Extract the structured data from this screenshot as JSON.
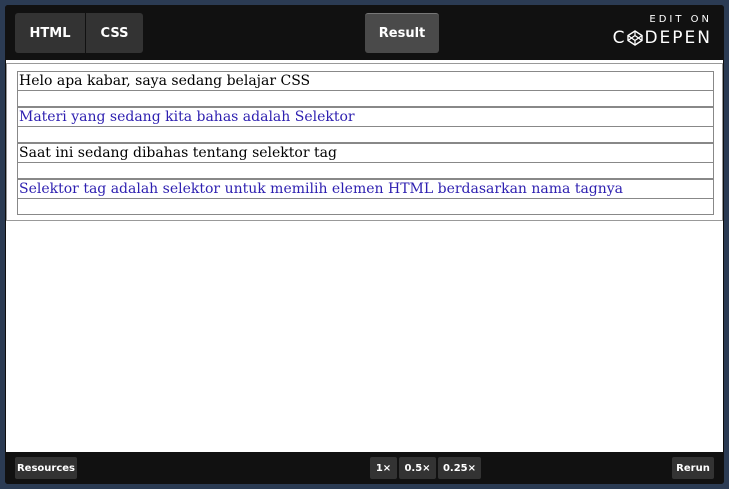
{
  "tabs": {
    "html": "HTML",
    "css": "CSS",
    "result": "Result"
  },
  "branding": {
    "edit_on": "EDIT ON",
    "logo_text_a": "C",
    "logo_text_b": "DEPEN"
  },
  "result": {
    "paragraphs": [
      "Helo apa kabar, saya sedang belajar CSS",
      "Materi yang sedang kita bahas adalah Selektor",
      "Saat ini sedang dibahas tentang selektor tag",
      "Selektor tag adalah selektor untuk memilih elemen HTML berdasarkan nama tagnya"
    ]
  },
  "footer": {
    "resources": "Resources",
    "zoom": [
      "1×",
      "0.5×",
      "0.25×"
    ],
    "rerun": "Rerun"
  },
  "colors": {
    "topbar": "#111111",
    "tab_bg": "#333333",
    "active_tab_bg": "#4a4a4a",
    "odd_text": "#000000",
    "even_text": "#2d1fb0",
    "outer_bg": "#2b3b53"
  },
  "icons": {
    "logo": "codepen-cube-icon"
  }
}
